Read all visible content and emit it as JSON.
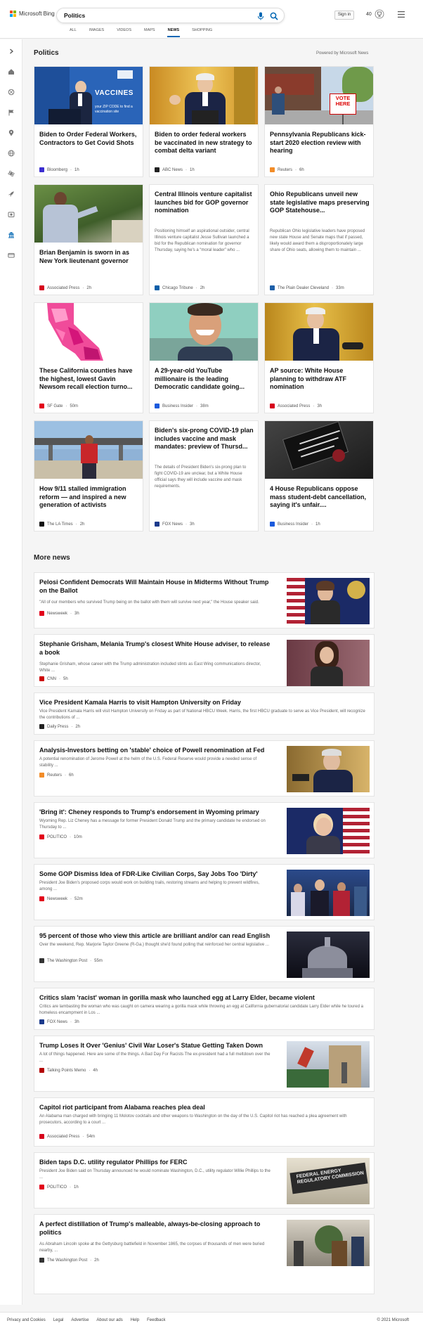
{
  "header": {
    "brand": "Microsoft Bing",
    "search_value": "Politics",
    "signin_label": "Sign in",
    "points": "40",
    "tabs": [
      {
        "label": "ALL"
      },
      {
        "label": "IMAGES"
      },
      {
        "label": "VIDEOS"
      },
      {
        "label": "MAPS"
      },
      {
        "label": "NEWS"
      },
      {
        "label": "SHOPPING"
      }
    ],
    "active_tab": "NEWS"
  },
  "section": {
    "title": "Politics",
    "powered_by": "Powered by Microsoft News"
  },
  "cards": [
    {
      "title": "Biden to Order Federal Workers, Contractors to Get Covid Shots",
      "source": "Bloomberg",
      "age": "1h",
      "fav_color": "#3b2ed0",
      "image_text_1": "VACCINES",
      "image_text_2": "your ZIP CODE to find a vaccination site"
    },
    {
      "title": "Biden to order federal workers be vaccinated in new strategy to combat delta variant",
      "source": "ABC News",
      "age": "1h",
      "fav_color": "#222222"
    },
    {
      "title": "Pennsylvania Republicans kick-start 2020 election review with hearing",
      "source": "Reuters",
      "age": "6h",
      "fav_color": "#f28c28",
      "image_text_1": "VOTE HERE"
    },
    {
      "title": "Brian Benjamin is sworn in as New York lieutenant governor",
      "source": "Associated Press",
      "age": "2h",
      "fav_color": "#d6001c"
    },
    {
      "title": "Central Illinois venture capitalist launches bid for GOP governor nomination",
      "desc": "Positioning himself an aspirational outsider, central Illinois venture capitalist Jesse Sullivan launched a bid for the Republican nomination for governor Thursday, saying he's a “moral leader” who ...",
      "source": "Chicago Tribune",
      "age": "2h",
      "fav_color": "#0a5fa8"
    },
    {
      "title": "Ohio Republicans unveil new state legislative maps preserving GOP Statehouse...",
      "desc": "Republican Ohio legislative leaders have proposed new state House and Senate maps that if passed, likely would award them a disproportionately large share of Ohio seats, allowing them to maintain ...",
      "source": "The Plain Dealer Cleveland",
      "age": "33m",
      "fav_color": "#1d5fa8"
    },
    {
      "title": "These California counties have the highest, lowest Gavin Newsom recall election turno...",
      "source": "SF Gate",
      "age": "50m",
      "fav_color": "#e2001a"
    },
    {
      "title": "A 29-year-old YouTube millionaire is the leading Democratic candidate going...",
      "source": "Business Insider",
      "age": "38m",
      "fav_color": "#1a5adc"
    },
    {
      "title": "AP source: White House planning to withdraw ATF nomination",
      "source": "Associated Press",
      "age": "3h",
      "fav_color": "#d6001c"
    },
    {
      "title": "How 9/11 stalled immigration reform — and inspired a new generation of activists",
      "source": "The LA Times",
      "age": "2h",
      "fav_color": "#111111"
    },
    {
      "title": "Biden's six-prong COVID-19 plan includes vaccine and mask mandates: preview of Thursd...",
      "desc": "The details of President Biden's six-prong plan to fight COVID-19 are unclear, but a White House official says they will include vaccine and mask requirements.",
      "source": "FOX News",
      "age": "3h",
      "fav_color": "#1b3a8c"
    },
    {
      "title": "4 House Republicans oppose mass student-debt cancellation, saying it's unfair....",
      "source": "Business Insider",
      "age": "1h",
      "fav_color": "#1a5adc"
    }
  ],
  "more_news": {
    "title": "More news",
    "items": [
      {
        "title": "Pelosi Confident Democrats Will Maintain House in Midterms Without Trump on the Ballot",
        "snippet": "\"All of our members who survived Trump being on the ballot with them will survive next year,\" the House speaker said.",
        "source": "Newsweek",
        "age": "3h",
        "fav_color": "#e2001a"
      },
      {
        "title": "Stephanie Grisham, Melania Trump's closest White House adviser, to release a book",
        "snippet": "Stephanie Grisham, whose career with the Trump administration included stints as East Wing communications director, White ...",
        "source": "CNN",
        "age": "5h",
        "fav_color": "#cc0000"
      },
      {
        "title": "Vice President Kamala Harris to visit Hampton University on Friday",
        "snippet": "Vice President Kamala Harris will visit Hampton University on Friday as part of National HBCU Week. Harris, the first HBCU graduate to serve as Vice President, will recognize the contributions of ...",
        "source": "Daily Press",
        "age": "2h",
        "fav_color": "#222222"
      },
      {
        "title": "Analysis-Investors betting on 'stable' choice of Powell renomination at Fed",
        "snippet": "A potential renomination of Jerome Powell at the helm of the U.S. Federal Reserve would provide a needed sense of stability ...",
        "source": "Reuters",
        "age": "6h",
        "fav_color": "#f28c28"
      },
      {
        "title": "'Bring it': Cheney responds to Trump's endorsement in Wyoming primary",
        "snippet": "Wyoming Rep. Liz Cheney has a message for former President Donald Trump and the primary candidate he endorsed on Thursday to ...",
        "source": "POLITICO",
        "age": "10m",
        "fav_color": "#e2001a"
      },
      {
        "title": "Some GOP Dismiss Idea of FDR-Like Civilian Corps, Say Jobs Too 'Dirty'",
        "snippet": "President Joe Biden's proposed corps would work on building trails, restoring streams and helping to prevent wildfires, among ...",
        "source": "Newsweek",
        "age": "52m",
        "fav_color": "#e2001a"
      },
      {
        "title": "95 percent of those who view this article are brilliant and/or can read English",
        "snippet": "Over the weekend, Rep. Marjorie Taylor Greene (R-Ga.) thought she'd found polling that reinforced her central legislative ...",
        "source": "The Washington Post",
        "age": "55m",
        "fav_color": "#333333"
      },
      {
        "title": "Critics slam 'racist' woman in gorilla mask who launched egg at Larry Elder, became violent",
        "snippet": "Critics are lambasting the woman who was caught on camera wearing a gorilla mask while throwing an egg at California gubernatorial candidate Larry Elder while he toured a homeless encampment in Los ...",
        "source": "FOX News",
        "age": "3h",
        "fav_color": "#1b3a8c"
      },
      {
        "title": "Trump Loses It Over 'Genius' Civil War Loser's Statue Getting Taken Down",
        "snippet": "A lot of things happened. Here are some of the things. A Bad Day For Racists The ex-president had a full meltdown over the ...",
        "source": "Talking Points Memo",
        "age": "4h",
        "fav_color": "#b30000"
      },
      {
        "title": "Capitol riot participant from Alabama reaches plea deal",
        "snippet": "An Alabama man charged with bringing 11 Molotov cocktails and other weapons to Washington on the day of the U.S. Capitol riot has reached a plea agreement with prosecutors, according to a court ...",
        "source": "Associated Press",
        "age": "54m",
        "fav_color": "#d6001c"
      },
      {
        "title": "Biden taps D.C. utility regulator Phillips for FERC",
        "snippet": "President Joe Biden said on Thursday announced he would nominate Washington, D.C., utility regulator Willie Phillips to the ...",
        "source": "POLITICO",
        "age": "1h",
        "fav_color": "#e2001a",
        "image_text_1": "FEDERAL ENERGY",
        "image_text_2": "REGULATORY COMMISSION"
      },
      {
        "title": "A perfect distillation of Trump's malleable, always-be-closing approach to politics",
        "snippet": "As Abraham Lincoln spoke at the Gettysburg battlefield in November 1865, the corpses of thousands of men were buried nearby, ...",
        "source": "The Washington Post",
        "age": "2h",
        "fav_color": "#333333"
      }
    ]
  },
  "footer": {
    "links": [
      "Privacy and Cookies",
      "Legal",
      "Advertise",
      "About our ads",
      "Help",
      "Feedback"
    ],
    "copyright": "© 2021 Microsoft"
  }
}
